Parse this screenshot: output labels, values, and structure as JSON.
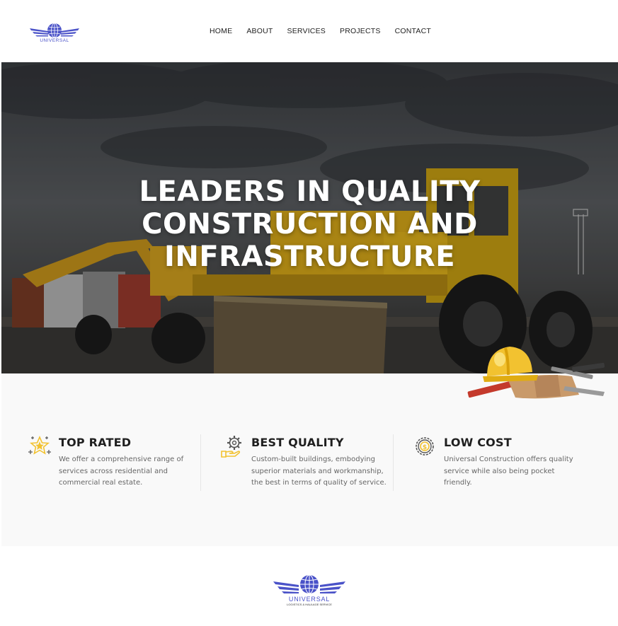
{
  "header": {
    "logo_text": "UNIVERSAL",
    "nav": [
      "HOME",
      "ABOUT",
      "SERVICES",
      "PROJECTS",
      "CONTACT"
    ]
  },
  "hero": {
    "title_lines": [
      "LEADERS IN QUALITY",
      "CONSTRUCTION AND",
      "INFRASTRUCTURE"
    ]
  },
  "features": [
    {
      "icon": "star-icon",
      "title": "TOP RATED",
      "text": "We offer a comprehensive range of services across residential and commercial real estate."
    },
    {
      "icon": "gear-hand-icon",
      "title": "BEST QUALITY",
      "text": "Custom-built buildings, embodying superior materials and workmanship, the best in terms of quality of service."
    },
    {
      "icon": "coin-gear-icon",
      "title": "LOW COST",
      "text": "Universal Construction offers quality service while also being pocket friendly."
    }
  ],
  "footer": {
    "logo_text": "UNIVERSAL",
    "logo_subtext": "LOGISTICS & HAULAGE SERVICE"
  },
  "colors": {
    "brand": "#4a52c8",
    "accent_yellow": "#f2c230",
    "text_dark": "#1f1f1f",
    "text_muted": "#666666",
    "features_bg": "#f9f9f9"
  }
}
